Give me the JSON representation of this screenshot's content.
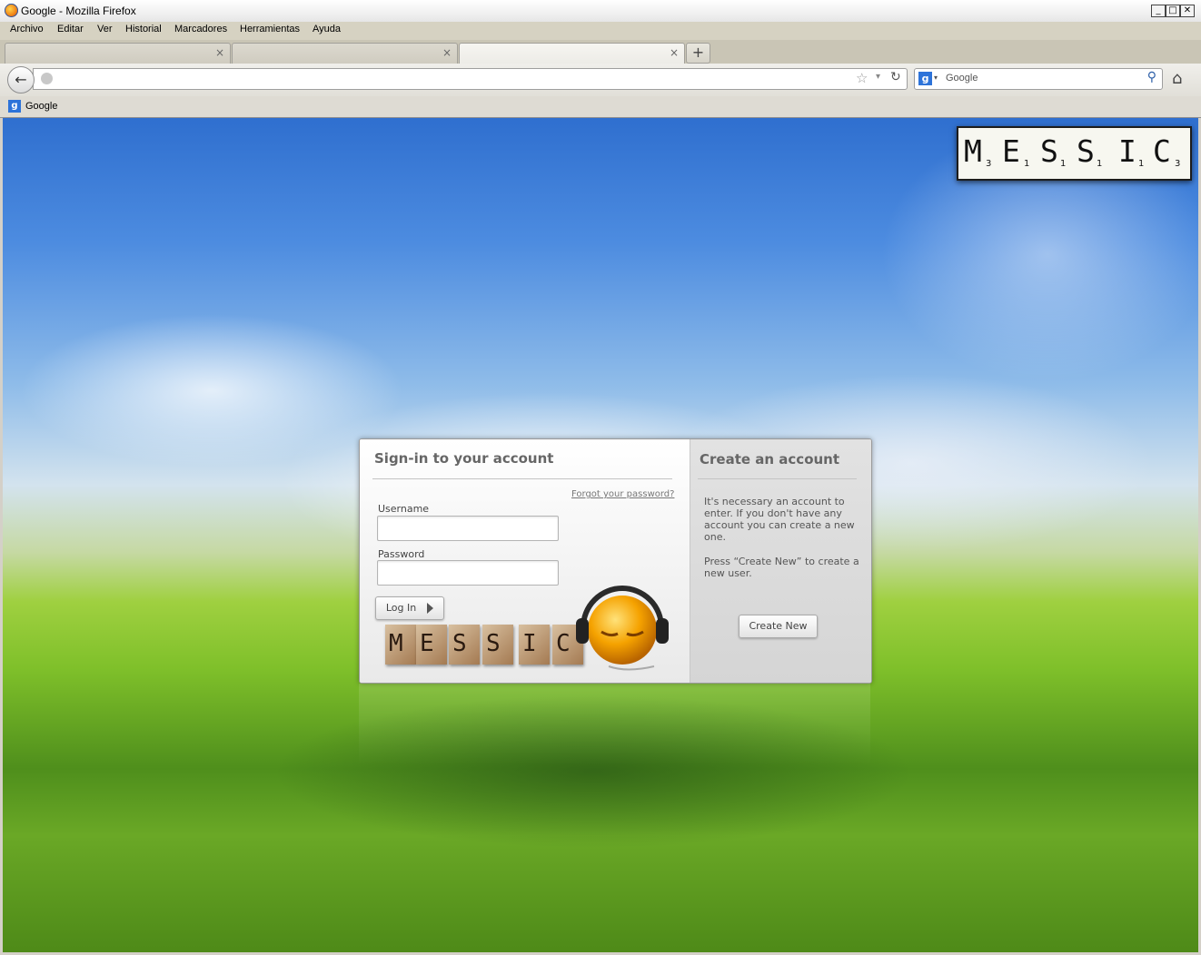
{
  "window": {
    "title": "Google - Mozilla Firefox",
    "min": "_",
    "max": "□",
    "close": "✕"
  },
  "menu": [
    "Archivo",
    "Editar",
    "Ver",
    "Historial",
    "Marcadores",
    "Herramientas",
    "Ayuda"
  ],
  "tabs": [
    {
      "label": "",
      "close": "×"
    },
    {
      "label": "",
      "close": "×"
    },
    {
      "label": "",
      "close": "×"
    }
  ],
  "newtab_label": "+",
  "nav": {
    "back": "←",
    "url": "",
    "search_placeholder": "Google",
    "star": "☆",
    "dropdown": "▾",
    "reload": "↻",
    "home": "⌂"
  },
  "bookmarks": [
    {
      "label": "Google"
    }
  ],
  "logo": {
    "letters": [
      "M",
      "E",
      "S",
      "S",
      "I",
      "C"
    ],
    "subs": [
      "3",
      "1",
      "1",
      "1",
      "1",
      "3"
    ]
  },
  "signin": {
    "title": "Sign-in to your account",
    "forgot": "Forgot your password?",
    "username_label": "Username",
    "password_label": "Password",
    "username_value": "",
    "password_value": "",
    "login_button": "Log In"
  },
  "create": {
    "title": "Create an account",
    "text1": "It's necessary an account to enter.  If you don't have any account you can create a new one.",
    "text2": "Press “Create New” to create a new user.",
    "button": "Create New"
  },
  "colors": {
    "accent": "#2d73d9",
    "card_bg": "#fafafa",
    "mascot": "#f5a200"
  }
}
